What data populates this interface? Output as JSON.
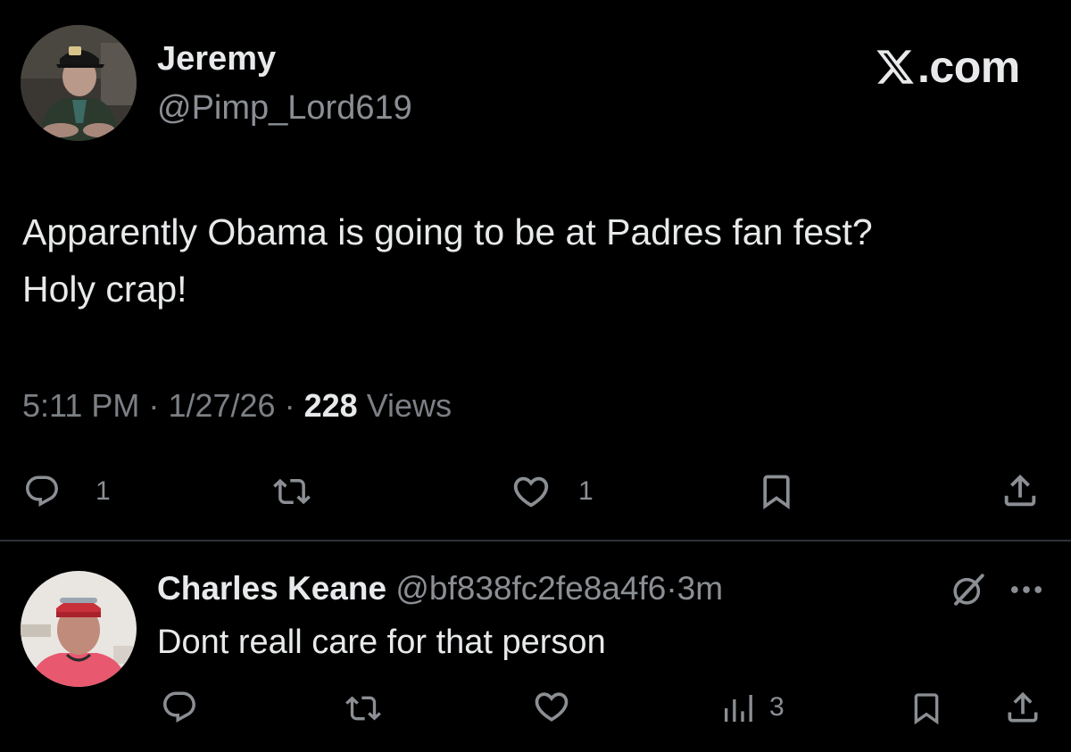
{
  "colors": {
    "background": "#000000",
    "primary_text": "#e7e9ea",
    "secondary_text": "#8b8f94",
    "divider": "#2f3336"
  },
  "brand": {
    "label": "X.com",
    "icon": "x-logo-icon"
  },
  "main_tweet": {
    "author_name": "Jeremy",
    "author_handle": "@Pimp_Lord619",
    "avatar": "avatar",
    "text": "Apparently Obama is going to be at Padres fan fest?\nHoly crap!",
    "time": "5:11 PM",
    "separator": "·",
    "date": "1/27/26",
    "views_count": "228",
    "views_label": "Views",
    "actions": {
      "reply": {
        "icon": "reply-icon",
        "count": "1"
      },
      "retweet": {
        "icon": "retweet-icon",
        "count": ""
      },
      "like": {
        "icon": "heart-icon",
        "count": "1"
      },
      "bookmark": {
        "icon": "bookmark-icon"
      },
      "share": {
        "icon": "share-icon"
      }
    }
  },
  "reply": {
    "author_name": "Charles Keane",
    "author_handle": "@bf838fc2fe8a4f6",
    "separator": "·",
    "time": "3m",
    "text": "Dont reall care for that person",
    "actions": {
      "reply": {
        "icon": "reply-icon"
      },
      "retweet": {
        "icon": "retweet-icon"
      },
      "like": {
        "icon": "heart-icon"
      },
      "views": {
        "icon": "views-chart-icon",
        "count": "3"
      },
      "bookmark": {
        "icon": "bookmark-icon"
      },
      "share": {
        "icon": "share-icon"
      }
    },
    "grok_icon": "grok-icon",
    "more_icon": "more-icon"
  }
}
